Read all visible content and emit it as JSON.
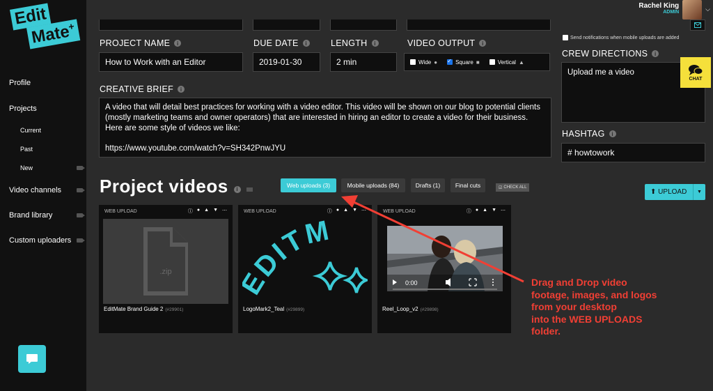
{
  "brand": {
    "logo_line1": "Edit",
    "logo_line2": "Mate",
    "logo_mark": "+"
  },
  "user": {
    "name": "Rachel King",
    "role": "ADMIN",
    "menu_icon": "chevron-down-icon"
  },
  "sidebar": {
    "items": [
      {
        "label": "Profile"
      },
      {
        "label": "Projects"
      },
      {
        "label": "Current"
      },
      {
        "label": "Past"
      },
      {
        "label": "New"
      },
      {
        "label": "Video channels"
      },
      {
        "label": "Brand library"
      },
      {
        "label": "Custom uploaders"
      }
    ]
  },
  "fields": {
    "project_name": {
      "label": "PROJECT NAME",
      "value": "How to Work with an Editor"
    },
    "due_date": {
      "label": "DUE DATE",
      "value": "2019-01-30"
    },
    "length": {
      "label": "LENGTH",
      "value": "2 min"
    },
    "video_output": {
      "label": "VIDEO OUTPUT",
      "options": [
        {
          "label": "Wide",
          "checked": false
        },
        {
          "label": "Square",
          "checked": true
        },
        {
          "label": "Vertical",
          "checked": false
        }
      ]
    },
    "creative_brief": {
      "label": "CREATIVE BRIEF",
      "value": "A video that will detail best practices for working with a video editor. This video will be shown on our blog to potential clients (mostly marketing teams and owner operators) that are interested in hiring an editor to create a video for their business. Here are some style of videos we like:",
      "link": "https://www.youtube.com/watch?v=SH342PnwJYU"
    },
    "notify": {
      "label": "Send notifications when mobile uploads are added",
      "checked": false
    },
    "crew_directions": {
      "label": "CREW DIRECTIONS",
      "value": "Upload me a video"
    },
    "hashtag": {
      "label": "HASHTAG",
      "value": "# howtowork"
    }
  },
  "chat_widget": {
    "label": "CHAT"
  },
  "project_videos": {
    "title": "Project videos",
    "tabs": [
      {
        "label": "Web uploads (3)",
        "active": true
      },
      {
        "label": "Mobile uploads (84)",
        "active": false
      },
      {
        "label": "Drafts (1)",
        "active": false
      },
      {
        "label": "Final cuts",
        "active": false
      }
    ],
    "check_all": "CHECK ALL",
    "upload_button": "UPLOAD",
    "cards": [
      {
        "source": "WEB UPLOAD",
        "name": "EditMate Brand Guide 2",
        "id": "(#29901)",
        "thumb_text": ".zip"
      },
      {
        "source": "WEB UPLOAD",
        "name": "LogoMark2_Teal",
        "id": "(#29899)",
        "thumb_text": "EDITM"
      },
      {
        "source": "WEB UPLOAD",
        "name": "Reel_Loop_v2",
        "id": "(#29898)",
        "time": "0:00"
      }
    ]
  },
  "annotation": {
    "lines": [
      "Drag and Drop video",
      "footage, images, and logos",
      "from your desktop",
      "into the WEB UPLOADS",
      "folder."
    ],
    "color": "#f13f34"
  },
  "colors": {
    "accent": "#3ccbd6",
    "panel": "#0f0f0f",
    "background": "#2b2b2b",
    "chat_yellow": "#f5e03b"
  }
}
